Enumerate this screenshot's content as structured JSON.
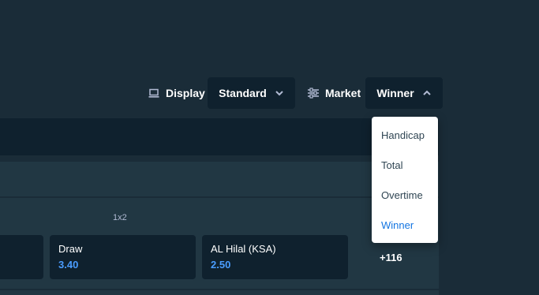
{
  "toolbar": {
    "display_label": "Display",
    "display_icon": "laptop-icon",
    "display_value": "Standard",
    "market_label": "Market",
    "market_icon": "sliders-icon",
    "market_value": "Winner"
  },
  "market_dropdown": {
    "options": [
      "Handicap",
      "Total",
      "Overtime",
      "Winner"
    ],
    "selected": "Winner"
  },
  "market_row": {
    "column_label": "1x2",
    "outcomes": [
      {
        "name": "Draw",
        "price": "3.40"
      },
      {
        "name": "AL Hilal (KSA)",
        "price": "2.50"
      }
    ],
    "more_markets": "+116"
  },
  "colors": {
    "background": "#1a2c38",
    "panel": "#213743",
    "card": "#0f212e",
    "price": "#4a9dff",
    "dropdown_active": "#1475e1",
    "dropdown_text": "#2f4553"
  }
}
